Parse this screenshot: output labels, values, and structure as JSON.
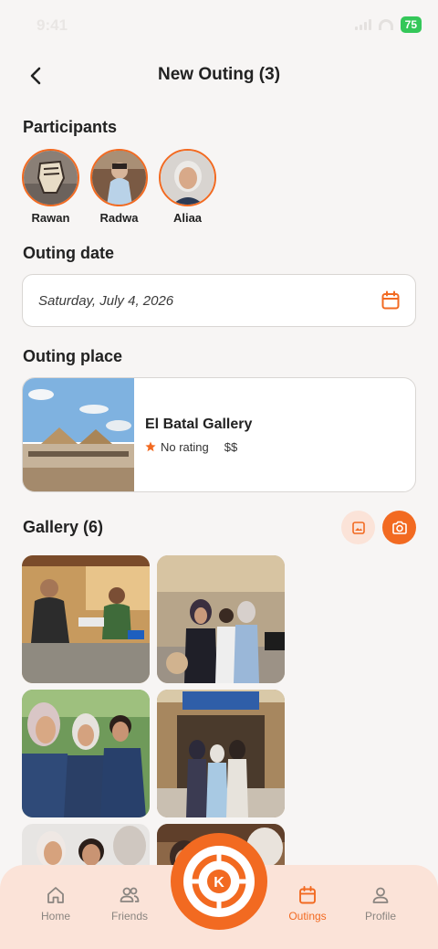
{
  "status_bar": {
    "time": "9:41",
    "battery": "75"
  },
  "header": {
    "title": "New Outing (3)"
  },
  "participants": {
    "title": "Participants",
    "items": [
      {
        "name": "Rawan"
      },
      {
        "name": "Radwa"
      },
      {
        "name": "Aliaa"
      }
    ]
  },
  "outing_date": {
    "title": "Outing date",
    "value": "Saturday, July 4, 2026"
  },
  "outing_place": {
    "title": "Outing place",
    "name": "El Batal Gallery",
    "rating": "No rating",
    "price": "$$"
  },
  "gallery": {
    "title": "Gallery (6)"
  },
  "tab_bar": {
    "items": [
      {
        "label": "Home"
      },
      {
        "label": "Friends"
      },
      {
        "label": "Outings"
      },
      {
        "label": "Profile"
      }
    ],
    "active": "Outings",
    "fab_letter": "K"
  },
  "colors": {
    "accent": "#f26a21",
    "accent_light": "#fbe3d8",
    "background": "#f7f5f4"
  }
}
